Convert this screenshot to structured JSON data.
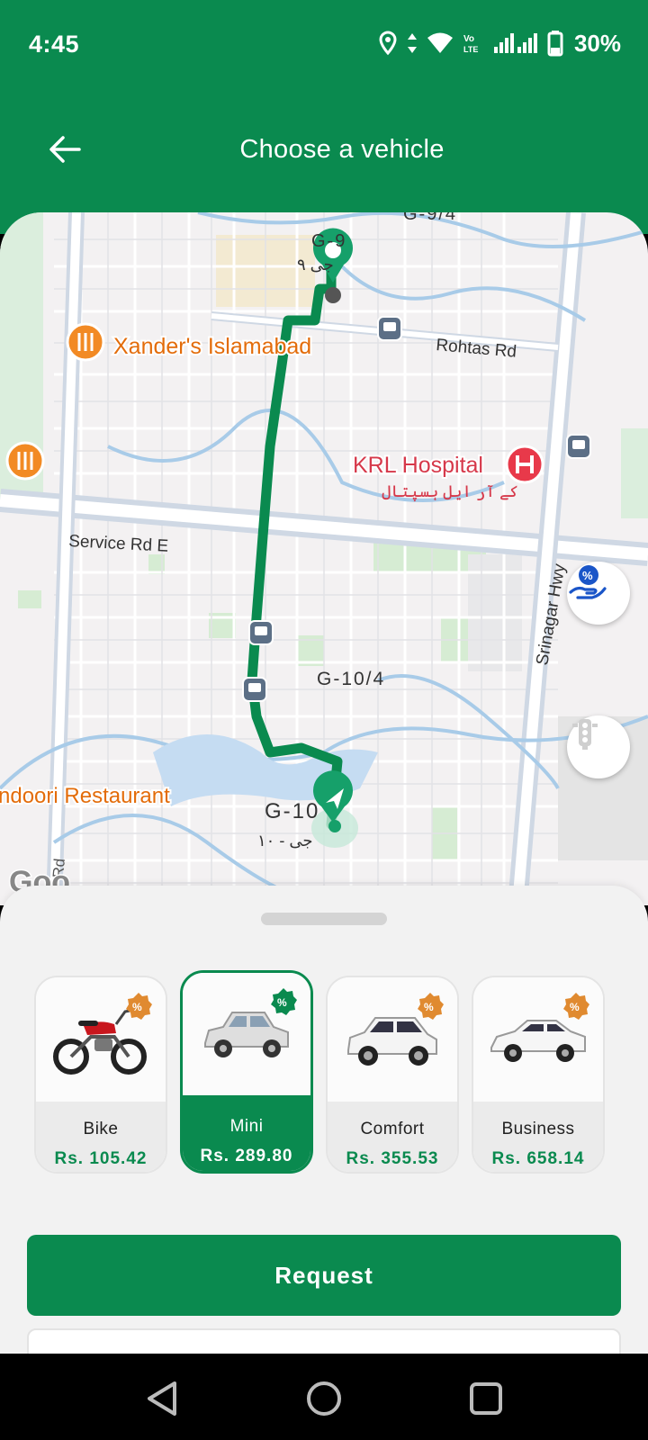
{
  "status_bar": {
    "time": "4:45",
    "network_label": "Vo LTE",
    "battery_percent": "30%"
  },
  "header": {
    "title": "Choose a vehicle",
    "back_icon": "arrow-left-icon",
    "background_color": "#0a8a4f"
  },
  "map": {
    "area_labels": {
      "g94": "G-9/4",
      "g9": "G-9",
      "g9_urdu": "جی ۹",
      "g104": "G-10/4",
      "g10": "G-10",
      "g10_urdu": "جی - ۱۰"
    },
    "roads": {
      "rohtas": "Rohtas Rd",
      "service": "Service Rd E",
      "srinagar": "Srinagar Hwy",
      "rd": "Rd"
    },
    "places": {
      "xanders": "Xander's Islamabad",
      "krl": "KRL Hospital",
      "krl_urdu": "کے آر ایل ہسپتال",
      "tandoori": "ndoori Restaurant"
    },
    "attribution": "Goo",
    "route_color": "#0a8a4f"
  },
  "map_controls": {
    "promo_icon": "hand-percent-icon",
    "traffic_icon": "traffic-light-icon"
  },
  "vehicles": [
    {
      "name": "Bike",
      "price": "Rs. 105.42",
      "icon": "motorbike-icon",
      "selected": false
    },
    {
      "name": "Mini",
      "price": "Rs. 289.80",
      "icon": "mini-car-icon",
      "selected": true
    },
    {
      "name": "Comfort",
      "price": "Rs. 355.53",
      "icon": "hatchback-car-icon",
      "selected": false
    },
    {
      "name": "Business",
      "price": "Rs. 658.14",
      "icon": "sedan-car-icon",
      "selected": false
    }
  ],
  "actions": {
    "request_label": "Request"
  },
  "nav": {
    "back": "nav-back-icon",
    "home": "nav-home-icon",
    "recents": "nav-recents-icon"
  }
}
